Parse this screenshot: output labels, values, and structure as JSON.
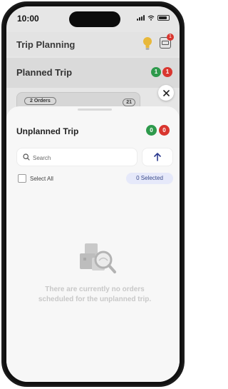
{
  "status_bar": {
    "time": "10:00"
  },
  "header": {
    "title": "Trip Planning",
    "notification_count": "1"
  },
  "planned_trip": {
    "title": "Planned Trip",
    "green_count": "1",
    "red_count": "1",
    "card": {
      "orders_label": "2 Orders",
      "number": "21"
    }
  },
  "sheet": {
    "title": "Unplanned Trip",
    "green_count": "0",
    "red_count": "0",
    "search": {
      "placeholder": "Search"
    },
    "select_all_label": "Select All",
    "selected_label": "0 Selected",
    "empty_message": "There are currently no orders scheduled for the unplanned trip."
  },
  "colors": {
    "green": "#2e9a4c",
    "red": "#d9362f",
    "accent": "#2b3a8f"
  },
  "icons": [
    "lightbulb-icon",
    "package-icon",
    "close-icon",
    "search-icon",
    "arrow-up-icon",
    "empty-orders-icon"
  ]
}
